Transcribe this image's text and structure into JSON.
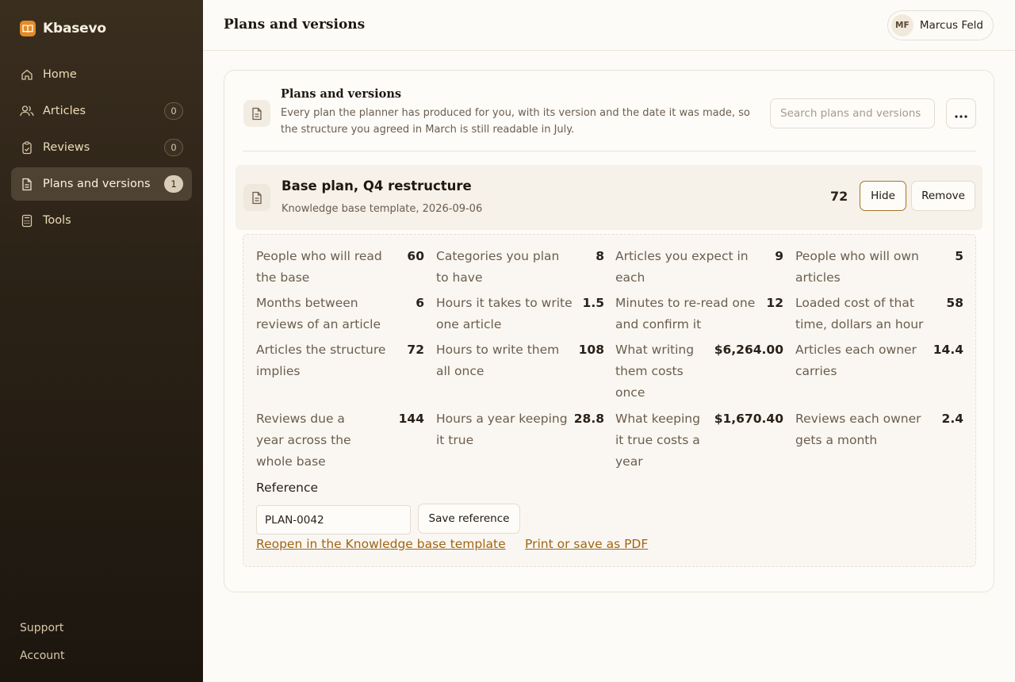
{
  "brand": {
    "name": "Kbasevo",
    "icon": "book-icon"
  },
  "nav": [
    {
      "label": "Home",
      "icon": "home-icon"
    },
    {
      "label": "Articles",
      "icon": "users-icon",
      "badge": "0"
    },
    {
      "label": "Reviews",
      "icon": "clipboard-check-icon",
      "badge": "0"
    },
    {
      "label": "Plans and versions",
      "icon": "document-icon",
      "badge": "1",
      "active": true
    },
    {
      "label": "Tools",
      "icon": "calculator-icon"
    }
  ],
  "footer": {
    "support": "Support",
    "account": "Account"
  },
  "header": {
    "title": "Plans and versions",
    "user": {
      "initials": "MF",
      "name": "Marcus Feld"
    }
  },
  "card": {
    "title": "Plans and versions",
    "description": "Every plan the planner has produced for you, with its version and the date it was made, so the structure you agreed in March is still readable in July.",
    "search_placeholder": "Search plans and versions"
  },
  "plan": {
    "title": "Base plan, Q4 restructure",
    "subtitle": "Knowledge base template, 2026-09-06",
    "count": "72",
    "hide_label": "Hide",
    "remove_label": "Remove",
    "metrics": [
      {
        "label": "People who will read the base",
        "value": "60"
      },
      {
        "label": "Categories you plan to have",
        "value": "8"
      },
      {
        "label": "Articles you expect in each",
        "value": "9"
      },
      {
        "label": "People who will own articles",
        "value": "5"
      },
      {
        "label": "Months between reviews of an article",
        "value": "6"
      },
      {
        "label": "Hours it takes to write one article",
        "value": "1.5"
      },
      {
        "label": "Minutes to re-read one and confirm it",
        "value": "12"
      },
      {
        "label": "Loaded cost of that time, dollars an hour",
        "value": "58"
      },
      {
        "label": "Articles the structure implies",
        "value": "72"
      },
      {
        "label": "Hours to write them all once",
        "value": "108"
      },
      {
        "label": "What writing them costs once",
        "value": "$6,264.00"
      },
      {
        "label": "Articles each owner carries",
        "value": "14.4"
      },
      {
        "label": "Reviews due a year across the whole base",
        "value": "144"
      },
      {
        "label": "Hours a year keeping it true",
        "value": "28.8"
      },
      {
        "label": "What keeping it true costs a year",
        "value": "$1,670.40"
      },
      {
        "label": "Reviews each owner gets a month",
        "value": "2.4"
      }
    ],
    "reference_label": "Reference",
    "reference_value": "PLAN-0042",
    "save_reference_label": "Save reference",
    "reopen_link": "Reopen in the Knowledge base template",
    "print_link": "Print or save as PDF"
  }
}
